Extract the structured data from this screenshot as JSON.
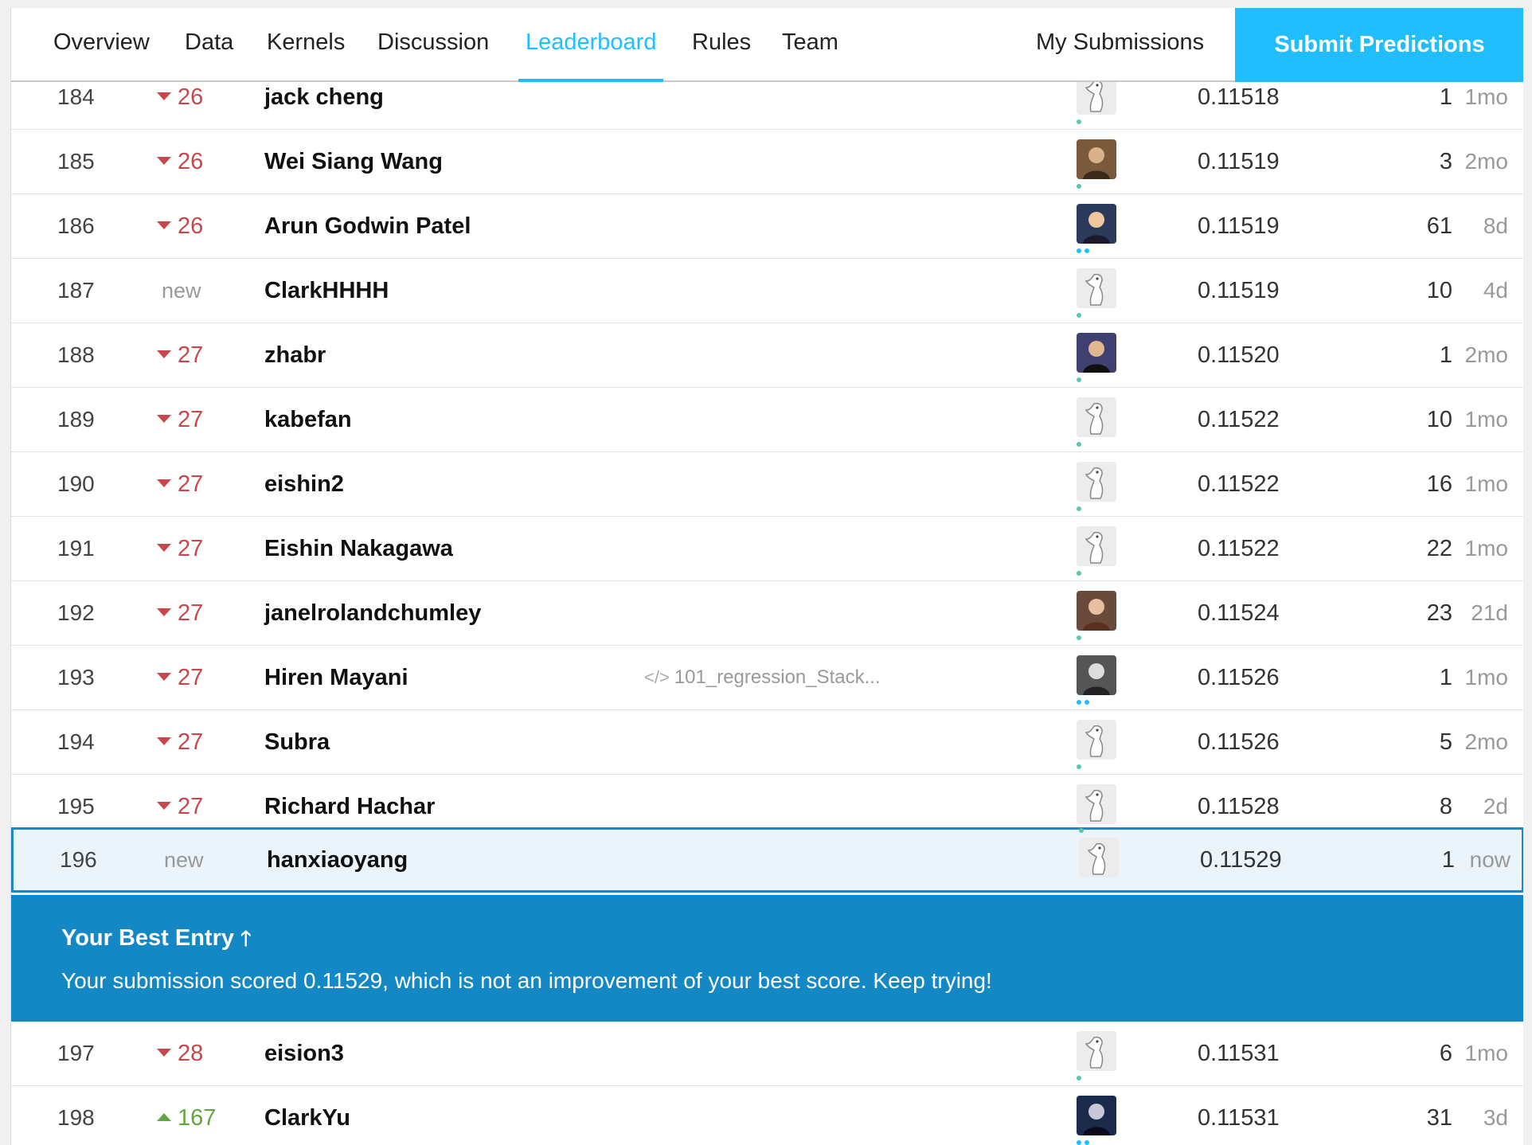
{
  "nav": {
    "tabs": [
      {
        "label": "Overview",
        "active": false
      },
      {
        "label": "Data",
        "active": false
      },
      {
        "label": "Kernels",
        "active": false
      },
      {
        "label": "Discussion",
        "active": false
      },
      {
        "label": "Leaderboard",
        "active": true
      },
      {
        "label": "Rules",
        "active": false
      },
      {
        "label": "Team",
        "active": false
      }
    ],
    "my_submissions": "My Submissions",
    "submit": "Submit Predictions"
  },
  "colors": {
    "accent": "#20BEFF",
    "banner": "#1388c4",
    "down": "#c7474b",
    "up": "#5fa640"
  },
  "rows": [
    {
      "rank": "184",
      "change_type": "down",
      "change": "26",
      "team": "jack cheng",
      "kernel": "",
      "avatar": "kaggle-bird-icon",
      "tier": "novice",
      "score": "0.11518",
      "entries": "1",
      "last": "1mo"
    },
    {
      "rank": "185",
      "change_type": "down",
      "change": "26",
      "team": "Wei Siang Wang",
      "kernel": "",
      "avatar": "photo-avatar",
      "tier": "novice",
      "score": "0.11519",
      "entries": "3",
      "last": "2mo"
    },
    {
      "rank": "186",
      "change_type": "down",
      "change": "26",
      "team": "Arun Godwin Patel",
      "kernel": "",
      "avatar": "photo-avatar",
      "tier": "expert",
      "score": "0.11519",
      "entries": "61",
      "last": "8d"
    },
    {
      "rank": "187",
      "change_type": "new",
      "change": "new",
      "team": "ClarkHHHH",
      "kernel": "",
      "avatar": "kaggle-bird-icon",
      "tier": "novice",
      "score": "0.11519",
      "entries": "10",
      "last": "4d"
    },
    {
      "rank": "188",
      "change_type": "down",
      "change": "27",
      "team": "zhabr",
      "kernel": "",
      "avatar": "photo-avatar",
      "tier": "novice",
      "score": "0.11520",
      "entries": "1",
      "last": "2mo"
    },
    {
      "rank": "189",
      "change_type": "down",
      "change": "27",
      "team": "kabefan",
      "kernel": "",
      "avatar": "kaggle-bird-icon",
      "tier": "novice",
      "score": "0.11522",
      "entries": "10",
      "last": "1mo"
    },
    {
      "rank": "190",
      "change_type": "down",
      "change": "27",
      "team": "eishin2",
      "kernel": "",
      "avatar": "kaggle-bird-icon",
      "tier": "novice",
      "score": "0.11522",
      "entries": "16",
      "last": "1mo"
    },
    {
      "rank": "191",
      "change_type": "down",
      "change": "27",
      "team": "Eishin Nakagawa",
      "kernel": "",
      "avatar": "kaggle-bird-icon",
      "tier": "novice",
      "score": "0.11522",
      "entries": "22",
      "last": "1mo"
    },
    {
      "rank": "192",
      "change_type": "down",
      "change": "27",
      "team": "janelrolandchumley",
      "kernel": "",
      "avatar": "photo-avatar",
      "tier": "novice",
      "score": "0.11524",
      "entries": "23",
      "last": "21d"
    },
    {
      "rank": "193",
      "change_type": "down",
      "change": "27",
      "team": "Hiren Mayani",
      "kernel": "101_regression_Stack...",
      "avatar": "photo-avatar",
      "tier": "expert",
      "score": "0.11526",
      "entries": "1",
      "last": "1mo"
    },
    {
      "rank": "194",
      "change_type": "down",
      "change": "27",
      "team": "Subra",
      "kernel": "",
      "avatar": "kaggle-bird-icon",
      "tier": "novice",
      "score": "0.11526",
      "entries": "5",
      "last": "2mo"
    },
    {
      "rank": "195",
      "change_type": "down",
      "change": "27",
      "team": "Richard Hachar",
      "kernel": "",
      "avatar": "kaggle-bird-icon",
      "tier": "novice",
      "score": "0.11528",
      "entries": "8",
      "last": "2d"
    }
  ],
  "my_row": {
    "rank": "196",
    "change_type": "new",
    "change": "new",
    "team": "hanxiaoyang",
    "kernel": "",
    "avatar": "kaggle-bird-icon",
    "tier": "novice",
    "score": "0.11529",
    "entries": "1",
    "last": "now"
  },
  "banner": {
    "title": "Your Best Entry",
    "arrow": "🡑",
    "message": "Your submission scored 0.11529, which is not an improvement of your best score. Keep trying!"
  },
  "rows_after": [
    {
      "rank": "197",
      "change_type": "down",
      "change": "28",
      "team": "eision3",
      "kernel": "",
      "avatar": "kaggle-bird-icon",
      "tier": "novice",
      "score": "0.11531",
      "entries": "6",
      "last": "1mo"
    },
    {
      "rank": "198",
      "change_type": "up",
      "change": "167",
      "team": "ClarkYu",
      "kernel": "",
      "avatar": "photo-avatar",
      "tier": "expert",
      "score": "0.11531",
      "entries": "31",
      "last": "3d"
    }
  ]
}
